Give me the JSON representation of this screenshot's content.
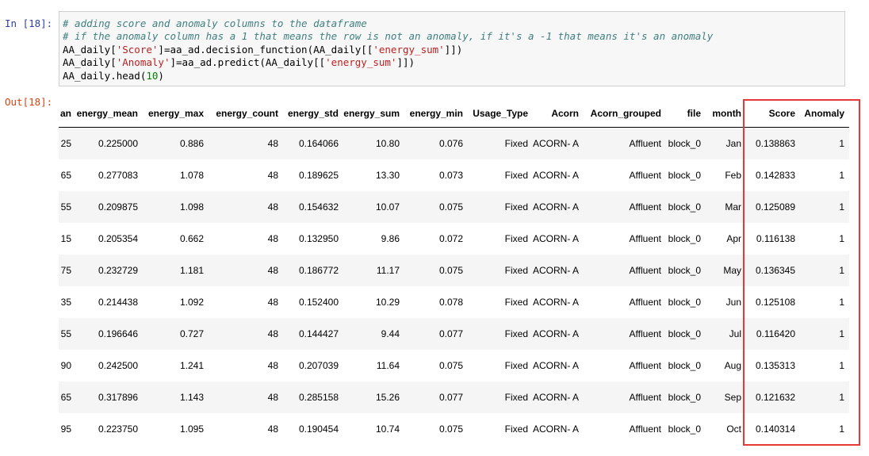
{
  "prompts": {
    "in": "In [18]:",
    "out": "Out[18]:"
  },
  "code": {
    "line1": "# adding score and anomaly columns to the dataframe",
    "line2": "# if the anomaly column has a 1 that means the row is not an anomaly, if it's a -1 that means it's an anomaly",
    "line3": {
      "a": "AA_daily[",
      "b": "'Score'",
      "c": "]=aa_ad.decision_function(AA_daily[[",
      "d": "'energy_sum'",
      "e": "]])"
    },
    "line4": {
      "a": "AA_daily[",
      "b": "'Anomaly'",
      "c": "]=aa_ad.predict(AA_daily[[",
      "d": "'energy_sum'",
      "e": "]])"
    },
    "line5": {
      "a": "AA_daily.head(",
      "b": "10",
      "c": ")"
    }
  },
  "table": {
    "columns": [
      "an",
      "energy_mean",
      "energy_max",
      "energy_count",
      "energy_std",
      "energy_sum",
      "energy_min",
      "Usage_Type",
      "Acorn",
      "Acorn_grouped",
      "file",
      "month",
      "Score",
      "Anomaly"
    ],
    "rows": [
      [
        "25",
        "0.225000",
        "0.886",
        "48",
        "0.164066",
        "10.80",
        "0.076",
        "Fixed",
        "ACORN-\nA",
        "Affluent",
        "block_0",
        "Jan",
        "0.138863",
        "1"
      ],
      [
        "65",
        "0.277083",
        "1.078",
        "48",
        "0.189625",
        "13.30",
        "0.073",
        "Fixed",
        "ACORN-\nA",
        "Affluent",
        "block_0",
        "Feb",
        "0.142833",
        "1"
      ],
      [
        "55",
        "0.209875",
        "1.098",
        "48",
        "0.154632",
        "10.07",
        "0.075",
        "Fixed",
        "ACORN-\nA",
        "Affluent",
        "block_0",
        "Mar",
        "0.125089",
        "1"
      ],
      [
        "15",
        "0.205354",
        "0.662",
        "48",
        "0.132950",
        "9.86",
        "0.072",
        "Fixed",
        "ACORN-\nA",
        "Affluent",
        "block_0",
        "Apr",
        "0.116138",
        "1"
      ],
      [
        "75",
        "0.232729",
        "1.181",
        "48",
        "0.186772",
        "11.17",
        "0.075",
        "Fixed",
        "ACORN-\nA",
        "Affluent",
        "block_0",
        "May",
        "0.136345",
        "1"
      ],
      [
        "35",
        "0.214438",
        "1.092",
        "48",
        "0.152400",
        "10.29",
        "0.078",
        "Fixed",
        "ACORN-\nA",
        "Affluent",
        "block_0",
        "Jun",
        "0.125108",
        "1"
      ],
      [
        "55",
        "0.196646",
        "0.727",
        "48",
        "0.144427",
        "9.44",
        "0.077",
        "Fixed",
        "ACORN-\nA",
        "Affluent",
        "block_0",
        "Jul",
        "0.116420",
        "1"
      ],
      [
        "90",
        "0.242500",
        "1.241",
        "48",
        "0.207039",
        "11.64",
        "0.075",
        "Fixed",
        "ACORN-\nA",
        "Affluent",
        "block_0",
        "Aug",
        "0.135313",
        "1"
      ],
      [
        "65",
        "0.317896",
        "1.143",
        "48",
        "0.285158",
        "15.26",
        "0.077",
        "Fixed",
        "ACORN-\nA",
        "Affluent",
        "block_0",
        "Sep",
        "0.121632",
        "1"
      ],
      [
        "95",
        "0.223750",
        "1.095",
        "48",
        "0.190454",
        "10.74",
        "0.075",
        "Fixed",
        "ACORN-\nA",
        "Affluent",
        "block_0",
        "Oct",
        "0.140314",
        "1"
      ]
    ]
  },
  "colors": {
    "highlight": "#e53935",
    "in_prompt": "#303f9f",
    "out_prompt": "#d84315"
  }
}
